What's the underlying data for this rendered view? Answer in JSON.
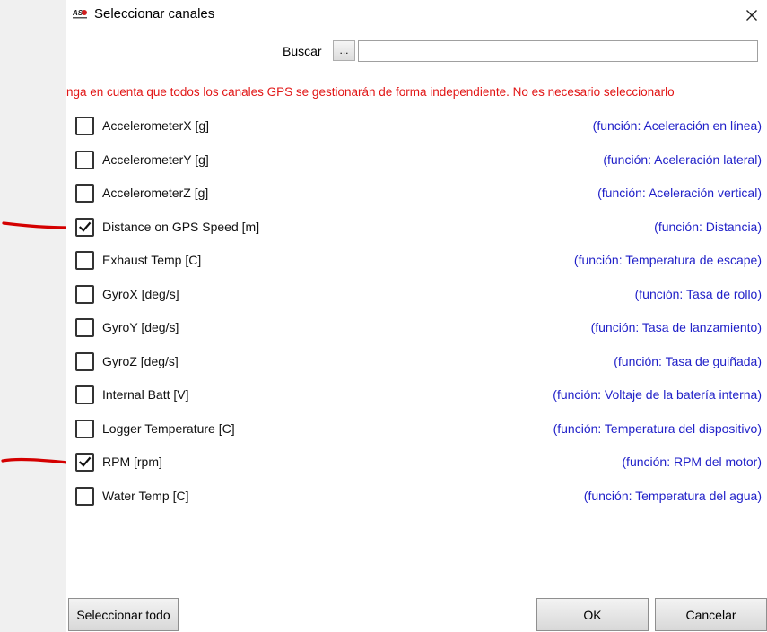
{
  "window": {
    "title": "Seleccionar canales",
    "close_glyph": "✕",
    "logo_icon": "aim-logo-icon"
  },
  "search": {
    "label": "Buscar",
    "button_label": "...",
    "value": "",
    "placeholder": ""
  },
  "note": {
    "text": "nga en cuenta que todos los canales GPS se gestionarán de forma independiente. No es necesario seleccionarlo"
  },
  "channels": [
    {
      "name": "AccelerometerX [g]",
      "function": "(función: Aceleración en línea)",
      "checked": false
    },
    {
      "name": "AccelerometerY [g]",
      "function": "(función: Aceleración lateral)",
      "checked": false
    },
    {
      "name": "AccelerometerZ [g]",
      "function": "(función: Aceleración vertical)",
      "checked": false
    },
    {
      "name": "Distance on GPS Speed [m]",
      "function": "(función: Distancia)",
      "checked": true
    },
    {
      "name": "Exhaust Temp [C]",
      "function": "(función: Temperatura de escape)",
      "checked": false
    },
    {
      "name": "GyroX [deg/s]",
      "function": "(función: Tasa de rollo)",
      "checked": false
    },
    {
      "name": "GyroY [deg/s]",
      "function": "(función: Tasa de lanzamiento)",
      "checked": false
    },
    {
      "name": "GyroZ [deg/s]",
      "function": "(función: Tasa de guiñada)",
      "checked": false
    },
    {
      "name": "Internal Batt [V]",
      "function": "(función: Voltaje de la batería interna)",
      "checked": false
    },
    {
      "name": "Logger Temperature [C]",
      "function": "(función: Temperatura del dispositivo)",
      "checked": false
    },
    {
      "name": "RPM [rpm]",
      "function": "(función: RPM del motor)",
      "checked": true
    },
    {
      "name": "Water Temp [C]",
      "function": "(función: Temperatura del agua)",
      "checked": false
    }
  ],
  "buttons": {
    "select_all": "Seleccionar todo",
    "ok": "OK",
    "cancel": "Cancelar"
  },
  "colors": {
    "note_text": "#e11616",
    "function_text": "#1f1fc8",
    "annotation_marks": "#d40000"
  }
}
